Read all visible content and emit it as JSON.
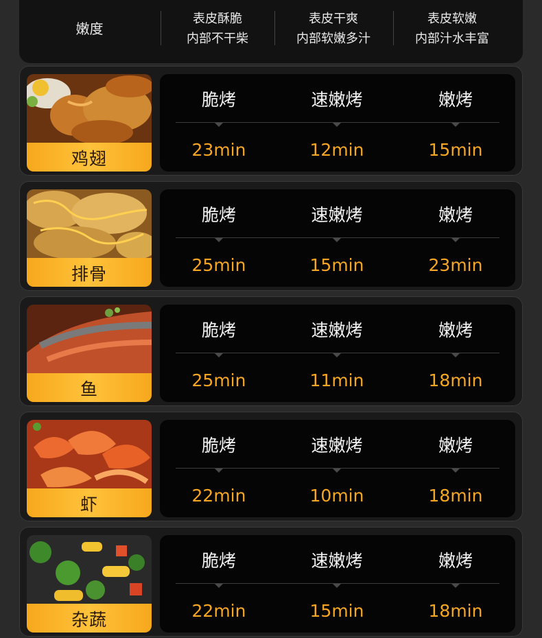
{
  "header": {
    "doneness_label": "嫩度",
    "columns": [
      {
        "line1": "表皮酥脆",
        "line2": "内部不干柴"
      },
      {
        "line1": "表皮干爽",
        "line2": "内部软嫩多汁"
      },
      {
        "line1": "表皮软嫩",
        "line2": "内部汁水丰富"
      }
    ]
  },
  "modes": [
    "脆烤",
    "速嫩烤",
    "嫩烤"
  ],
  "rows": [
    {
      "food": "鸡翅",
      "times": [
        "23min",
        "12min",
        "15min"
      ]
    },
    {
      "food": "排骨",
      "times": [
        "25min",
        "15min",
        "23min"
      ]
    },
    {
      "food": "鱼",
      "times": [
        "25min",
        "11min",
        "18min"
      ]
    },
    {
      "food": "虾",
      "times": [
        "22min",
        "10min",
        "18min"
      ]
    },
    {
      "food": "杂蔬",
      "times": [
        "22min",
        "15min",
        "18min"
      ]
    }
  ],
  "colors": {
    "accent": "#f5a623",
    "band": "#ffc23b",
    "panel": "#050505"
  }
}
